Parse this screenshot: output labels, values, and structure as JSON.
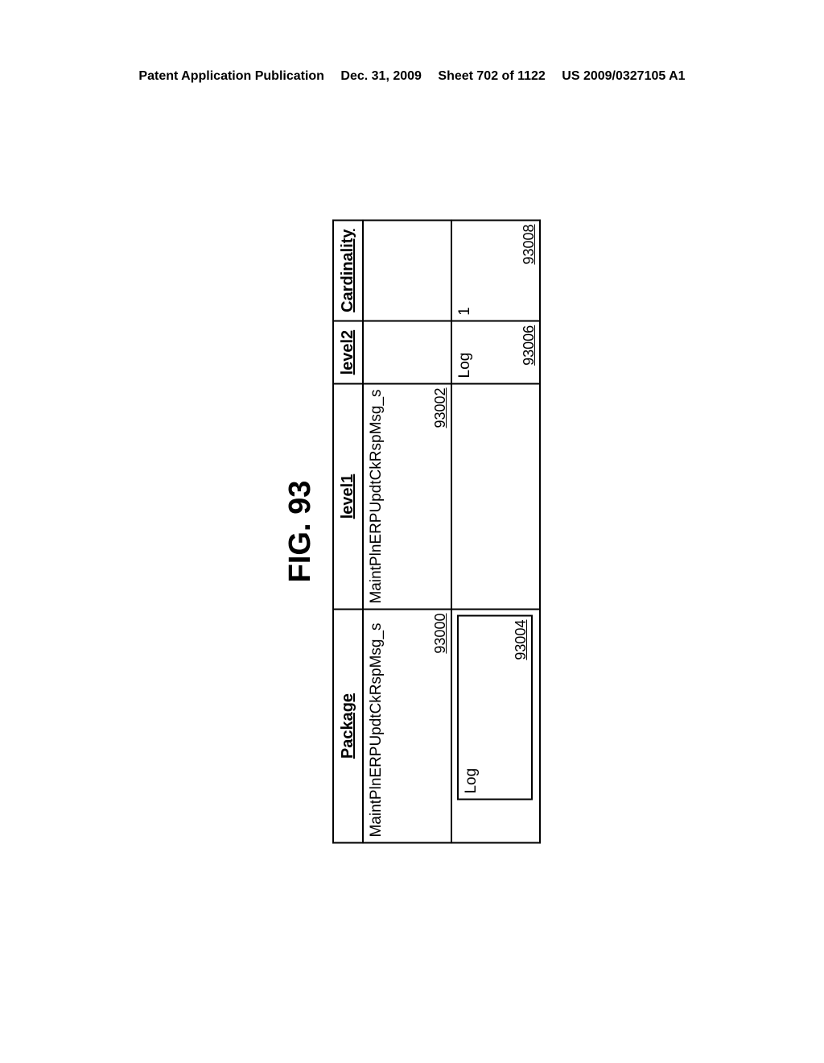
{
  "header": {
    "left": "Patent Application Publication",
    "date": "Dec. 31, 2009",
    "sheet": "Sheet 702 of 1122",
    "pubno": "US 2009/0327105 A1"
  },
  "figure": {
    "title": "FIG. 93",
    "columns": {
      "package": "Package",
      "level1": "level1",
      "level2": "level2",
      "cardinality": "Cardinality"
    },
    "rows": [
      {
        "package": {
          "text": "MaintPlnERPUpdtCkRspMsg_s",
          "ref": "93000"
        },
        "level1": {
          "text": "MaintPlnERPUpdtCkRspMsg_s",
          "ref": "93002"
        },
        "level2": {
          "text": "",
          "ref": ""
        },
        "cardinality": {
          "text": "",
          "ref": ""
        }
      },
      {
        "package_inner": {
          "text": "Log",
          "ref": "93004"
        },
        "level1": {
          "text": "",
          "ref": ""
        },
        "level2": {
          "text": "Log",
          "ref": "93006"
        },
        "cardinality": {
          "text": "1",
          "ref": "93008"
        }
      }
    ]
  }
}
